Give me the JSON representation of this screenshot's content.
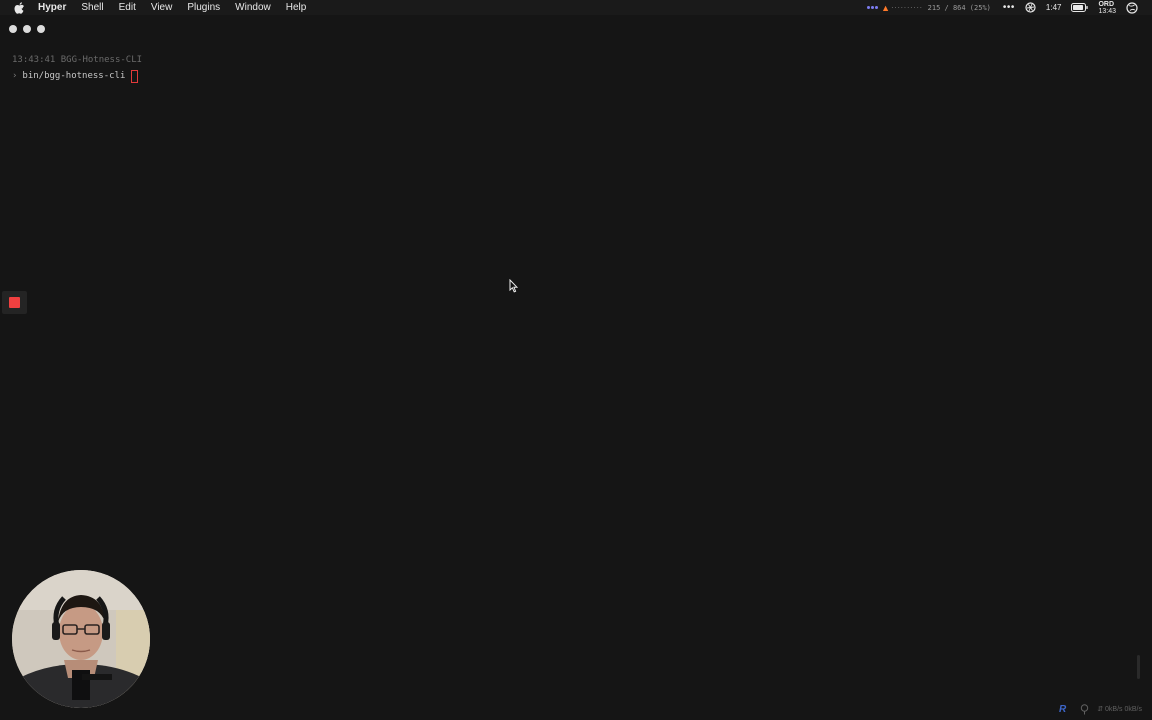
{
  "menubar": {
    "app_name": "Hyper",
    "items": [
      "Shell",
      "Edit",
      "View",
      "Plugins",
      "Window",
      "Help"
    ],
    "cpu_text": "215 / 864 (25%)",
    "more_dots": "•••",
    "time": "1:47",
    "tz_label": "ORD",
    "tz_time": "13:43"
  },
  "terminal": {
    "line1": "13:43:41 BGG-Hotness-CLI",
    "prompt_symbol": "›",
    "command": "bin/bgg-hotness-cli"
  },
  "statusbar": {
    "r_label": "R",
    "network": "⇵ 0kB/s 0kB/s"
  },
  "colors": {
    "background": "#151515",
    "cursor": "#e23a3a",
    "record": "#f04040",
    "status_accent": "#7c7cf0"
  }
}
